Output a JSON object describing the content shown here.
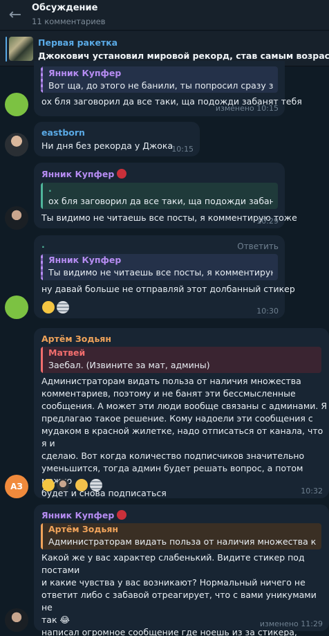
{
  "header": {
    "title": "Обсуждение",
    "subtitle": "11 комментариев",
    "back_icon": "arrow-left-icon"
  },
  "pinned": {
    "title": "Первая ракетка",
    "text": "Джокович установил мировой рекорд, став самым возрастным"
  },
  "messages": [
    {
      "reply_name": "Янник Купфер",
      "reply_text": "Вот ща, до этого не банили, ты попросил сразу забанят",
      "text": "ох бля заговорил да все таки, ща подожди забанят тебя",
      "time": "изменено 10:15"
    },
    {
      "name": "eastborn",
      "text": "Ни дня без рекорда у Джока",
      "time": "10:15"
    },
    {
      "name": "Янник Купфер",
      "reply_name": ".",
      "reply_text": "ох бля заговорил да все таки, ща подожди забанят тебя",
      "text": "Ты видимо не читаешь все посты, я комментирую тоже",
      "time": "10:29"
    },
    {
      "name": ".",
      "reply_action": "Ответить",
      "reply_name": "Янник Купфер",
      "reply_text": "Ты видимо не читаешь все посты, я комментирую...",
      "text": "ну давай больше не отправляй этот долбанный стикер",
      "time": "10:30"
    },
    {
      "name": "Артём Зодьян",
      "avatar_initials": "АЗ",
      "reply_name": "Матвей",
      "reply_text": "Заебал.  (Извините за мат, админы)",
      "text": "Администраторам видать польза от наличия множества\nкомментариев, поэтому и не банят эти бессмысленные\nсообщения. А может эти люди вообще связаны с админами. Я\nпредлагаю такое решение. Кому надоели эти сообщения с\nмудаком в красной жилетке, надо отписаться от канала, что я и\nсделаю. Вот когда количество подписчиков значительно\nуменьшится, тогда админ будет решать вопрос, а потом можно\nбудет и снова подписаться",
      "time": "10:32"
    },
    {
      "name": "Янник Купфер",
      "reply_name": "Артём Зодьян",
      "reply_text": "Администраторам видать польза от наличия множества ком...",
      "text": "Какой же у вас характер слабенький. Видите стикер под постами\nи какие чувства у вас возникают? Нормальный ничего не\nответит либо с забавой отреагирует, что с вами уникумами не\nтак 😂\nнаписал огромное сообщение где ноешь из за стикера,\nвдумайся",
      "time": "изменено 11:29"
    }
  ],
  "colors": {
    "background": "#0f1b25",
    "bubble": "#182533",
    "header": "#17212b",
    "accent_blue": "#5aaae6",
    "name_purple": "#b68cf2",
    "name_orange": "#f0a35a",
    "name_red": "#f26d6d",
    "avatar_green": "#7cc242",
    "avatar_orange": "#f08a3c"
  }
}
